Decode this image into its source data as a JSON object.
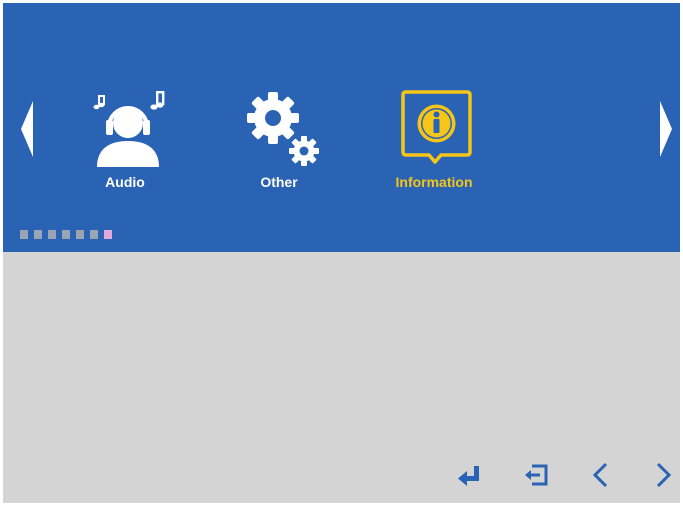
{
  "menu": {
    "items": [
      {
        "label": "Audio",
        "icon": "headphones-person-icon",
        "selected": false
      },
      {
        "label": "Other",
        "icon": "gears-icon",
        "selected": false
      },
      {
        "label": "Information",
        "icon": "info-icon",
        "selected": true
      }
    ],
    "page_indicator": {
      "total": 7,
      "active_index": 6
    }
  },
  "colors": {
    "panel_bg": "#2b63b4",
    "body_bg": "#d4d4d4",
    "selected": "#f5c518",
    "icon": "#ffffff",
    "nav_key": "#2b63b4",
    "dot": "#9aa4b4",
    "dot_active": "#e3a9d9"
  },
  "nav_keys": [
    {
      "name": "enter",
      "icon": "enter-icon"
    },
    {
      "name": "exit",
      "icon": "exit-icon"
    },
    {
      "name": "previous",
      "icon": "chevron-left-icon"
    },
    {
      "name": "next",
      "icon": "chevron-right-icon"
    }
  ]
}
